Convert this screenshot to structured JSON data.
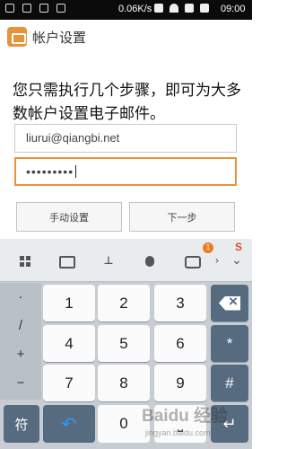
{
  "status_bar": {
    "speed": "0.06K/s",
    "time": "09:00",
    "icons": [
      "notification-icon",
      "notification-icon",
      "usb-icon",
      "notification-icon",
      "alarm-icon",
      "wifi-icon",
      "signal-icon",
      "battery-icon"
    ]
  },
  "app_bar": {
    "title": "帐户设置",
    "icon": "mail-icon"
  },
  "main": {
    "instruction": "您只需执行几个步骤，即可为大多数帐户设置电子邮件。",
    "email_value": "liurui@qiangbi.net",
    "password_value": "•••••••••",
    "manual_button": "手动设置",
    "next_button": "下一步"
  },
  "keyboard": {
    "badge_count": "1",
    "brand_icon": "S",
    "symbols": [
      "·",
      "/",
      "+",
      "−"
    ],
    "rows": [
      [
        "1",
        "2",
        "3"
      ],
      [
        "4",
        "5",
        "6"
      ],
      [
        "7",
        "8",
        "9"
      ]
    ],
    "right_keys": [
      "",
      "*",
      "#"
    ],
    "fu_key": "符",
    "zero_key": "0",
    "space_key": "⎵",
    "enter_icon": "enter-icon"
  },
  "watermark": {
    "logo": "Baidu 经验",
    "site": "jingyan.baidu.com"
  },
  "colors": {
    "accent": "#e8923a",
    "keyboard_dark": "#576b80",
    "keyboard_bg": "#c7cdd3"
  }
}
